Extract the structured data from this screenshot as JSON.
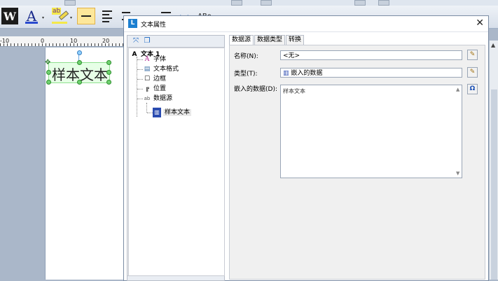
{
  "toolbar": {
    "logo_letter": "W",
    "font_color_letter": "A",
    "highlight_letters": "ab",
    "dropdown_arrow": "▾",
    "arrow_glyph": "⟷",
    "text_tool_label": "ABo"
  },
  "ruler": {
    "labels": [
      "-10",
      "0",
      "10",
      "20"
    ]
  },
  "canvas": {
    "sample_text": "样本文本"
  },
  "dialog": {
    "title": "文本属性",
    "close_glyph": "✕",
    "tree": {
      "root": "文本 1",
      "items": [
        "字体",
        "文本格式",
        "边框",
        "位置",
        "数据源"
      ],
      "child": "样本文本"
    },
    "tabs": [
      "数据源",
      "数据类型",
      "转换"
    ],
    "name_label": "名称(N):",
    "name_value": "<无>",
    "type_label": "类型(T):",
    "type_value": "嵌入的数据",
    "embedded_label": "嵌入的数据(D):",
    "embedded_value": "样本文本",
    "omega_glyph": "Ω"
  }
}
